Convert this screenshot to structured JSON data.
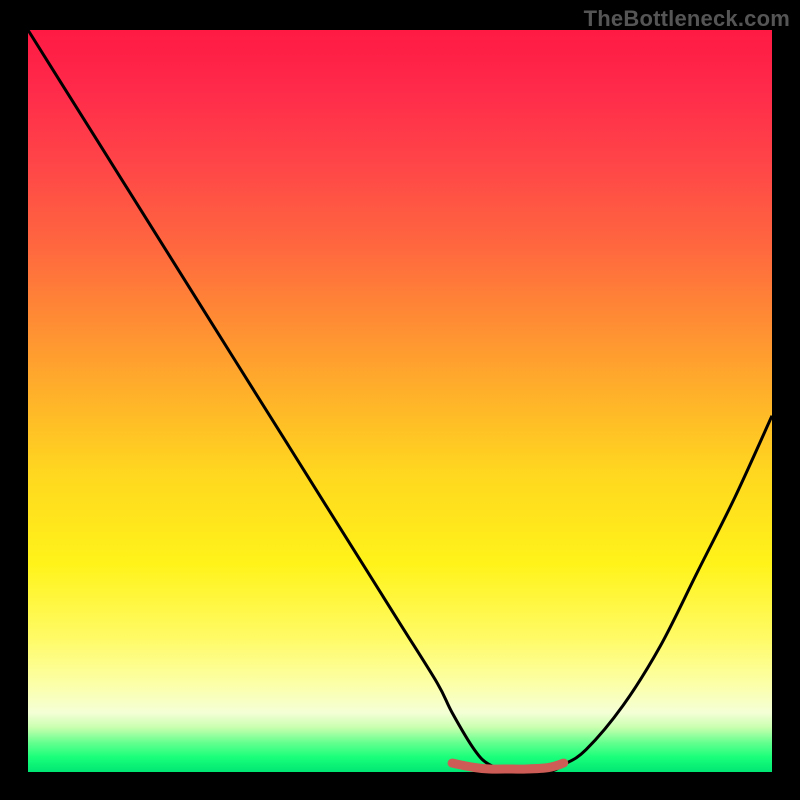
{
  "watermark": "TheBottleneck.com",
  "colors": {
    "frame": "#000000",
    "watermark_text": "#555555",
    "curve": "#000000",
    "bump": "#cc5c55",
    "gradient_top": "#ff1a44",
    "gradient_bottom": "#00e673"
  },
  "chart_data": {
    "type": "line",
    "title": "",
    "xlabel": "",
    "ylabel": "",
    "xlim": [
      0,
      100
    ],
    "ylim": [
      0,
      100
    ],
    "grid": false,
    "legend": false,
    "series": [
      {
        "name": "bottleneck-curve",
        "x": [
          0,
          5,
          10,
          15,
          20,
          25,
          30,
          35,
          40,
          45,
          50,
          55,
          57,
          60,
          62,
          65,
          67,
          70,
          72,
          75,
          80,
          85,
          90,
          95,
          100
        ],
        "y": [
          100,
          92,
          84,
          76,
          68,
          60,
          52,
          44,
          36,
          28,
          20,
          12,
          8,
          3,
          1,
          0,
          0,
          0,
          1,
          3,
          9,
          17,
          27,
          37,
          48
        ]
      },
      {
        "name": "optimal-range-marker",
        "x": [
          57,
          60,
          62,
          65,
          67,
          70,
          72
        ],
        "y": [
          1.2,
          0.6,
          0.4,
          0.4,
          0.4,
          0.6,
          1.2
        ]
      }
    ],
    "annotations": []
  }
}
